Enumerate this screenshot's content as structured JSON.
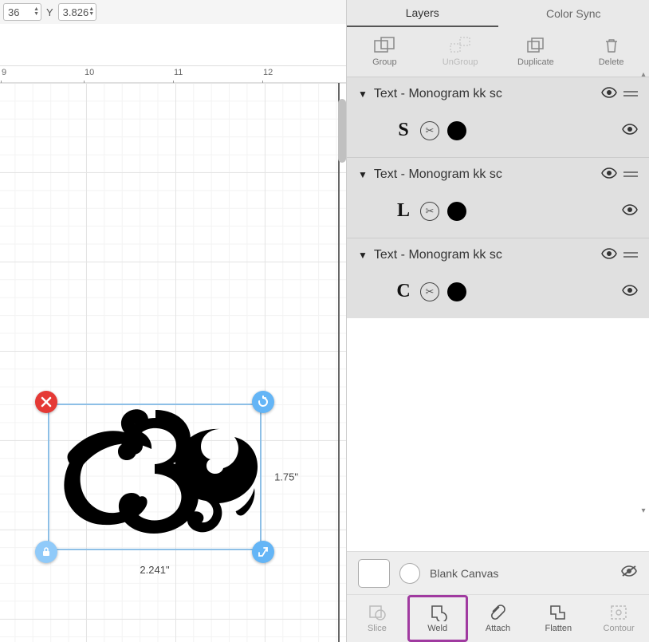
{
  "toolbar": {
    "value1": "36",
    "y_label": "Y",
    "value2": "3.826"
  },
  "ruler": {
    "marks": [
      "9",
      "10",
      "11",
      "12"
    ]
  },
  "selection": {
    "width_label": "2.241\"",
    "height_label": "1.75\""
  },
  "panel": {
    "tabs": {
      "layers": "Layers",
      "colorsync": "Color Sync",
      "active": "layers"
    },
    "actions": {
      "group": "Group",
      "ungroup": "UnGroup",
      "duplicate": "Duplicate",
      "delete": "Delete"
    },
    "layers": [
      {
        "title": "Text - Monogram kk sc",
        "glyph": "S"
      },
      {
        "title": "Text - Monogram kk sc",
        "glyph": "L"
      },
      {
        "title": "Text - Monogram kk sc",
        "glyph": "C"
      }
    ],
    "canvas_info": {
      "label": "Blank Canvas"
    },
    "ops": {
      "slice": "Slice",
      "weld": "Weld",
      "attach": "Attach",
      "flatten": "Flatten",
      "contour": "Contour"
    }
  }
}
